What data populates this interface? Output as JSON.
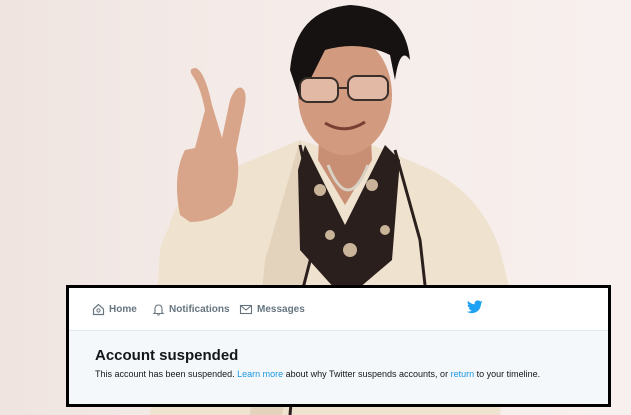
{
  "nav": {
    "home_label": "Home",
    "notifications_label": "Notifications",
    "messages_label": "Messages",
    "brand_icon": "twitter-bird-icon"
  },
  "notice": {
    "title": "Account suspended",
    "text_before": "This account has been suspended. ",
    "learn_more_link": "Learn more",
    "text_middle": " about why Twitter suspends accounts, or ",
    "return_link": "return",
    "text_after": " to your timeline."
  },
  "colors": {
    "link": "#1b95e0",
    "twitter_blue": "#1da1f2",
    "nav_text": "#66757f",
    "frame": "#000000"
  }
}
